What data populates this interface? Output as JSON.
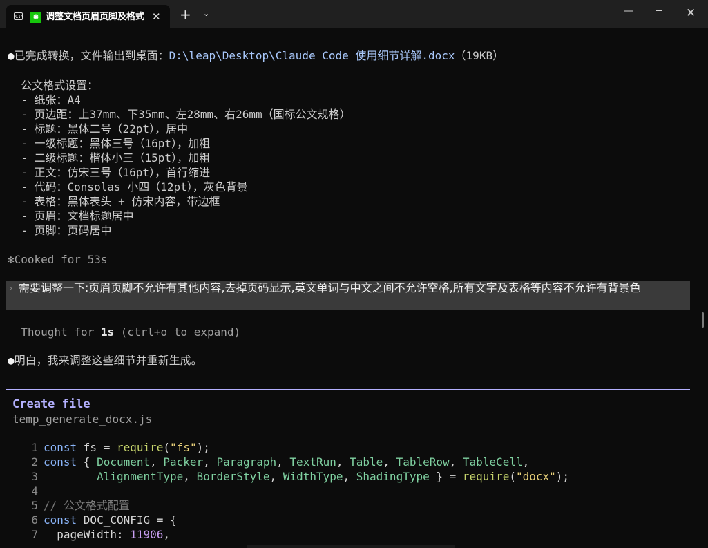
{
  "tab": {
    "title": "调整文档页眉页脚及格式",
    "close": "✕",
    "new_tab": "+",
    "dropdown": "⌄",
    "term_icon": "C:\\",
    "star": "✱"
  },
  "window": {
    "minimize": "—",
    "close": "✕"
  },
  "messages": {
    "done_bullet": "●",
    "done_text": "已完成转换，文件输出到桌面：",
    "done_path": "D:\\leap\\Desktop\\Claude Code 使用细节详解.docx",
    "done_size": "（19KB）",
    "format_heading": "  公文格式设置：",
    "format_items": [
      "  - 纸张：A4",
      "  - 页边距：上37mm、下35mm、左28mm、右26mm（国标公文规格）",
      "  - 标题：黑体二号（22pt），居中",
      "  - 一级标题：黑体三号（16pt），加粗",
      "  - 二级标题：楷体小三（15pt），加粗",
      "  - 正文：仿宋三号（16pt），首行缩进",
      "  - 代码：Consolas 小四（12pt），灰色背景",
      "  - 表格：黑体表头 + 仿宋内容，带边框",
      "  - 页眉：文档标题居中",
      "  - 页脚：页码居中"
    ],
    "cooked": "✻Cooked for 53s",
    "user_prompt_caret": "›",
    "user_prompt": "需要调整一下:页眉页脚不允许有其他内容,去掉页码显示,英文单词与中文之间不允许空格,所有文字及表格等内容不允许有背景色",
    "thought_prefix": "  Thought for ",
    "thought_time": "1s",
    "thought_suffix": " (ctrl+o to expand)",
    "reply_bullet": "●",
    "reply_text": "明白，我来调整这些细节并重新生成。"
  },
  "tool": {
    "title": "Create file",
    "file": "temp_generate_docx.js",
    "lines": [
      {
        "n": "1",
        "tokens": [
          [
            "kw",
            "const "
          ],
          [
            "pl",
            "fs = "
          ],
          [
            "fn",
            "require"
          ],
          [
            "pl",
            "("
          ],
          [
            "str",
            "\"fs\""
          ],
          [
            "pl",
            ");"
          ]
        ]
      },
      {
        "n": "2",
        "tokens": [
          [
            "kw",
            "const "
          ],
          [
            "pl",
            "{ "
          ],
          [
            "cls",
            "Document"
          ],
          [
            "pl",
            ", "
          ],
          [
            "cls",
            "Packer"
          ],
          [
            "pl",
            ", "
          ],
          [
            "cls",
            "Paragraph"
          ],
          [
            "pl",
            ", "
          ],
          [
            "cls",
            "TextRun"
          ],
          [
            "pl",
            ", "
          ],
          [
            "cls",
            "Table"
          ],
          [
            "pl",
            ", "
          ],
          [
            "cls",
            "TableRow"
          ],
          [
            "pl",
            ", "
          ],
          [
            "cls",
            "TableCell"
          ],
          [
            "pl",
            ","
          ]
        ]
      },
      {
        "n": "3",
        "tokens": [
          [
            "pl",
            "        "
          ],
          [
            "cls",
            "AlignmentType"
          ],
          [
            "pl",
            ", "
          ],
          [
            "cls",
            "BorderStyle"
          ],
          [
            "pl",
            ", "
          ],
          [
            "cls",
            "WidthType"
          ],
          [
            "pl",
            ", "
          ],
          [
            "cls",
            "ShadingType"
          ],
          [
            "pl",
            " } = "
          ],
          [
            "fn",
            "require"
          ],
          [
            "pl",
            "("
          ],
          [
            "str",
            "\"docx\""
          ],
          [
            "pl",
            ");"
          ]
        ]
      },
      {
        "n": "4",
        "tokens": []
      },
      {
        "n": "5",
        "tokens": [
          [
            "cm",
            "// 公文格式配置"
          ]
        ]
      },
      {
        "n": "6",
        "tokens": [
          [
            "kw",
            "const "
          ],
          [
            "pl",
            "DOC_CONFIG = {"
          ]
        ]
      },
      {
        "n": "7",
        "tokens": [
          [
            "pl",
            "  pageWidth: "
          ],
          [
            "num",
            "11906"
          ],
          [
            "pl",
            ","
          ]
        ]
      }
    ]
  }
}
